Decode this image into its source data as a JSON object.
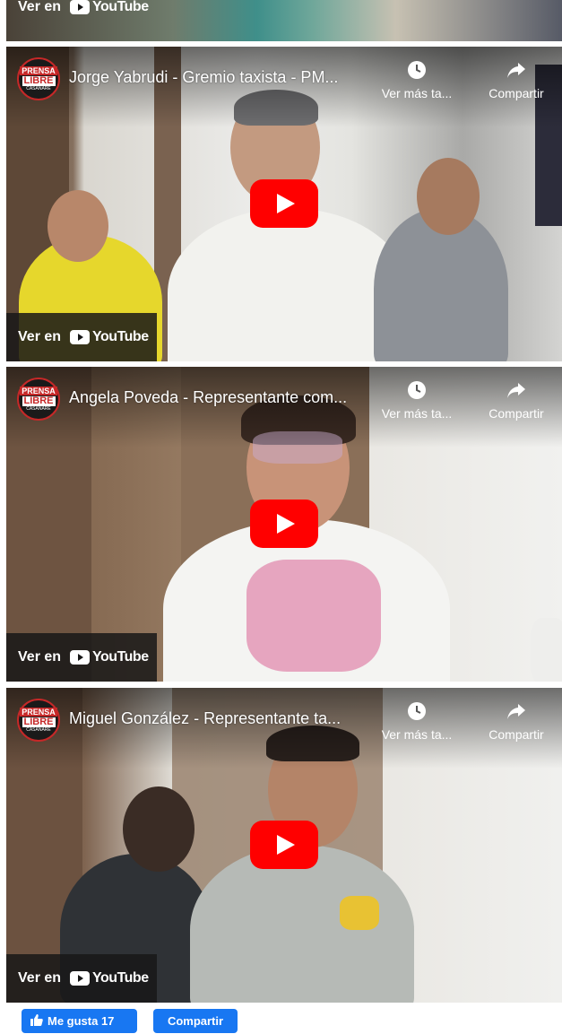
{
  "player": {
    "ver_en_label": "Ver en",
    "youtube_word": "YouTube",
    "watch_later_label": "Ver más ta...",
    "share_label": "Compartir"
  },
  "channel": {
    "logo_line1": "PRENSA",
    "logo_line2": "LIBRE",
    "logo_line3": "CASANARE"
  },
  "videos": [
    {
      "title": "Jorge Yabrudi - Gremio taxista - PM..."
    },
    {
      "title": "Angela Poveda - Representante com..."
    },
    {
      "title": "Miguel González - Representante ta..."
    }
  ],
  "facebook": {
    "like_label": "Me gusta 17",
    "share_label": "Compartir"
  },
  "colors": {
    "youtube_red": "#ff0000",
    "facebook_blue": "#1877f2"
  }
}
